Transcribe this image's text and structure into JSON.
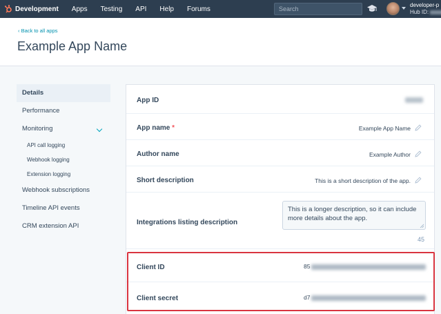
{
  "topnav": {
    "brand": "Development",
    "items": [
      "Apps",
      "Testing",
      "API",
      "Help",
      "Forums"
    ],
    "search_placeholder": "Search",
    "account_name": "developer-p",
    "hub_id_label": "Hub ID:"
  },
  "header": {
    "back_link": "‹ Back to all apps",
    "title": "Example App Name"
  },
  "sidebar": {
    "items": [
      "Details",
      "Performance",
      "Monitoring",
      "API call logging",
      "Webhook logging",
      "Extension logging",
      "Webhook subscriptions",
      "Timeline API events",
      "CRM extension API"
    ]
  },
  "details": {
    "app_id_label": "App ID",
    "app_name_label": "App name",
    "required_mark": "*",
    "app_name_value": "Example App Name",
    "author_label": "Author name",
    "author_value": "Example Author",
    "short_desc_label": "Short description",
    "short_desc_value": "This is a short description of the app.",
    "integrations_label": "Integrations listing description",
    "integrations_value": "This is a longer description, so it can include more details about the app.",
    "char_count": "45",
    "client_id_label": "Client ID",
    "client_id_prefix": "85",
    "client_secret_label": "Client secret",
    "client_secret_prefix": "d7"
  },
  "colors": {
    "nav_bg": "#2d3e50",
    "accent": "#ff7a59",
    "link": "#0091ae",
    "highlight": "#d9343f"
  }
}
